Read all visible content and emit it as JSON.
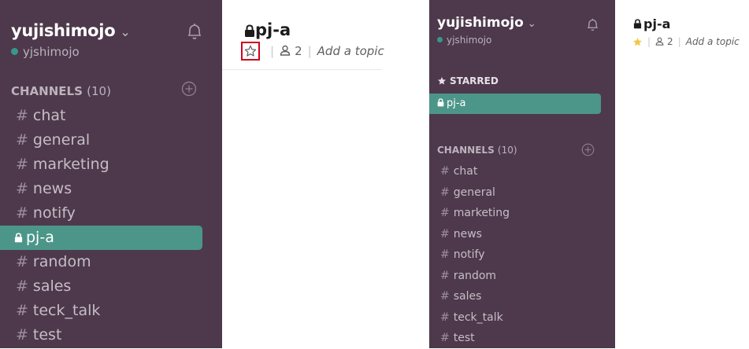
{
  "colors": {
    "sidebar_bg": "#4d394b",
    "active_teal": "#4c9689",
    "presence_green": "#38978d",
    "star_gold": "#f2c744",
    "highlight_red": "#d0021b"
  },
  "left": {
    "sidebar": {
      "team_name": "yujishimojo",
      "chevron": "⌄",
      "username": "yjshimojo",
      "channels_header": "CHANNELS",
      "channels_count": "(10)",
      "channels": [
        {
          "name": "chat",
          "private": false,
          "active": false
        },
        {
          "name": "general",
          "private": false,
          "active": false
        },
        {
          "name": "marketing",
          "private": false,
          "active": false
        },
        {
          "name": "news",
          "private": false,
          "active": false
        },
        {
          "name": "notify",
          "private": false,
          "active": false
        },
        {
          "name": "pj-a",
          "private": true,
          "active": true
        },
        {
          "name": "random",
          "private": false,
          "active": false
        },
        {
          "name": "sales",
          "private": false,
          "active": false
        },
        {
          "name": "teck_talk",
          "private": false,
          "active": false
        },
        {
          "name": "test",
          "private": false,
          "active": false
        }
      ]
    },
    "header": {
      "channel_title": "pj-a",
      "star_state": "unstarred",
      "member_count": "2",
      "topic_placeholder": "Add a topic",
      "separator": "|"
    }
  },
  "right": {
    "sidebar": {
      "team_name": "yujishimojo",
      "chevron": "⌄",
      "username": "yjshimojo",
      "starred_header": "STARRED",
      "starred_channel": "pj-a",
      "channels_header": "CHANNELS",
      "channels_count": "(10)",
      "channels": [
        "chat",
        "general",
        "marketing",
        "news",
        "notify",
        "random",
        "sales",
        "teck_talk",
        "test"
      ]
    },
    "header": {
      "channel_title": "pj-a",
      "star_state": "starred",
      "member_count": "2",
      "topic_placeholder": "Add a topic",
      "separator": "|"
    }
  },
  "hash_symbol": "#",
  "icons": [
    "bell-icon",
    "plus-circle-icon",
    "lock-icon",
    "star-outline-icon",
    "star-filled-icon",
    "person-icon",
    "presence-dot-icon"
  ]
}
